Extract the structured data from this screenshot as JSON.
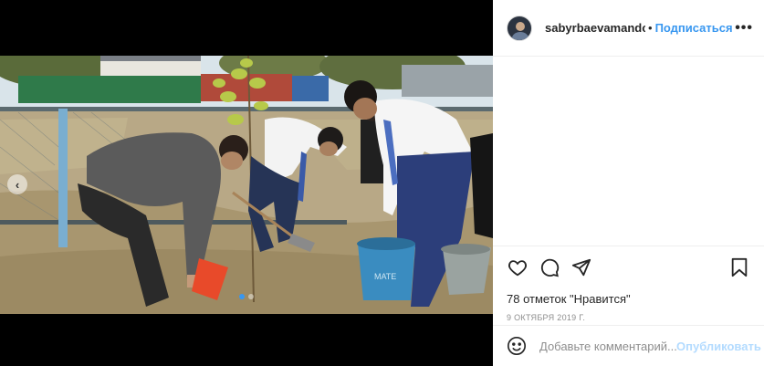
{
  "post": {
    "username": "sabyrbaevamandos",
    "separator": "•",
    "follow_label": "Подписаться",
    "more_label": "•••",
    "likes_text": "78 отметок \"Нравится\"",
    "date_text": "9 ОКТЯБРЯ 2019 Г.",
    "carousel_current_index": 0
  },
  "comment": {
    "placeholder": "Добавьте комментарий...",
    "publish_label": "Опубликовать"
  },
  "icons": {
    "like": "heart-icon",
    "comment": "speech-bubble-icon",
    "share": "paper-plane-icon",
    "save": "bookmark-icon",
    "emoji": "smiley-icon",
    "prev": "chevron-left-icon",
    "more": "ellipsis-icon"
  },
  "colors": {
    "accent": "#3897f0",
    "publish_disabled": "#b3dbff",
    "text": "#262626",
    "muted": "#8e8e8e"
  },
  "photo_text": {
    "bucket_label": "МАТЕ"
  }
}
